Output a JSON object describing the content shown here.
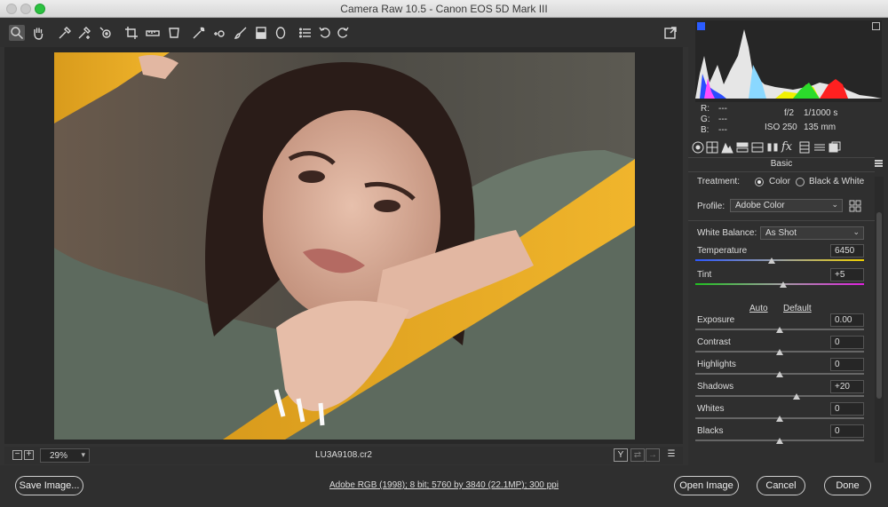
{
  "window": {
    "title": "Camera Raw 10.5  -  Canon EOS 5D Mark III"
  },
  "toolbar": {
    "tools": [
      "zoom-icon",
      "hand-icon",
      "white-balance-icon",
      "color-sampler-icon",
      "target-adjust-icon",
      "crop-icon",
      "straighten-icon",
      "transform-icon",
      "spot-removal-icon",
      "red-eye-icon",
      "adjustment-brush-icon",
      "graduated-filter-icon",
      "radial-filter-icon",
      "presets-list-icon",
      "rotate-ccw-icon",
      "rotate-cw-icon"
    ],
    "open_preferences": "toggle-fullscreen-icon"
  },
  "canvas": {
    "zoom": "29%",
    "filename": "LU3A9108.cr2"
  },
  "histogram": {
    "r_label": "R:",
    "r_value": "---",
    "g_label": "G:",
    "g_value": "---",
    "b_label": "B:",
    "b_value": "---",
    "aperture": "f/2",
    "shutter": "1/1000 s",
    "iso": "ISO 250",
    "focal": "135 mm"
  },
  "panel": {
    "title": "Basic",
    "treatment_label": "Treatment:",
    "treatment_color": "Color",
    "treatment_bw": "Black & White",
    "profile_label": "Profile:",
    "profile_value": "Adobe Color",
    "wb_label": "White Balance:",
    "wb_value": "As Shot",
    "auto": "Auto",
    "default": "Default",
    "sliders": [
      {
        "label": "Temperature",
        "value": "6450",
        "level": 0.45
      },
      {
        "label": "Tint",
        "value": "+5",
        "level": 0.52
      },
      {
        "label": "Exposure",
        "value": "0.00",
        "level": 0.5
      },
      {
        "label": "Contrast",
        "value": "0",
        "level": 0.5
      },
      {
        "label": "Highlights",
        "value": "0",
        "level": 0.5
      },
      {
        "label": "Shadows",
        "value": "+20",
        "level": 0.6
      },
      {
        "label": "Whites",
        "value": "0",
        "level": 0.5
      },
      {
        "label": "Blacks",
        "value": "0",
        "level": 0.5
      }
    ]
  },
  "footer": {
    "save": "Save Image...",
    "workflow": "Adobe RGB (1998); 8 bit; 5760 by 3840 (22.1MP); 300 ppi",
    "open": "Open Image",
    "cancel": "Cancel",
    "done": "Done"
  }
}
